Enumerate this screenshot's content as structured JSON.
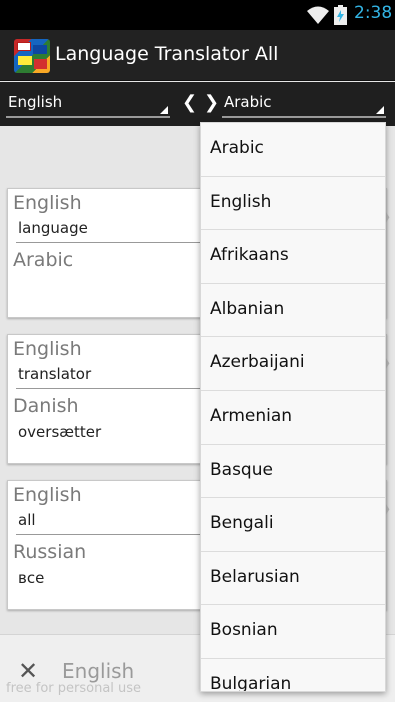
{
  "status": {
    "time": "2:38"
  },
  "app": {
    "title": "Language Translator All"
  },
  "selector": {
    "source": "English",
    "target": "Arabic",
    "prev": "❮",
    "next": "❯"
  },
  "cards": [
    {
      "src_lang": "English",
      "src_text": "language",
      "dst_lang": "Arabic",
      "dst_text": ""
    },
    {
      "src_lang": "English",
      "src_text": "translator",
      "dst_lang": "Danish",
      "dst_text": "oversætter"
    },
    {
      "src_lang": "English",
      "src_text": "all",
      "dst_lang": "Russian",
      "dst_text": "все"
    }
  ],
  "input": {
    "clear": "✕",
    "language": "English",
    "watermark": "free for personal use"
  },
  "dropdown": {
    "options": [
      "Arabic",
      "English",
      "Afrikaans",
      "Albanian",
      "Azerbaijani",
      "Armenian",
      "Basque",
      "Bengali",
      "Belarusian",
      "Bosnian",
      "Bulgarian"
    ]
  },
  "colors": {
    "accent": "#33b5e5",
    "actionbar": "#222222",
    "background": "#e6e6e6"
  },
  "icons": [
    "wifi-icon",
    "battery-icon",
    "app-icon",
    "chevron-left-icon",
    "chevron-right-icon",
    "clear-icon"
  ]
}
